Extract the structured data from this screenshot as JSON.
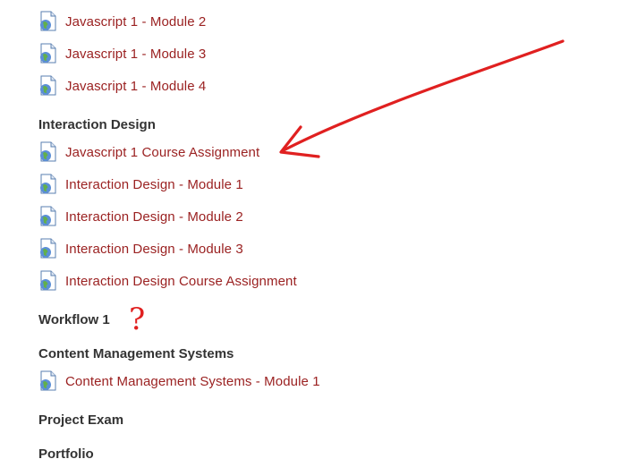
{
  "links_top": [
    {
      "label": "Javascript 1 - Module 2"
    },
    {
      "label": "Javascript 1 - Module 3"
    },
    {
      "label": "Javascript 1 - Module 4"
    }
  ],
  "section_interaction": {
    "title": "Interaction Design",
    "items": [
      {
        "label": "Javascript 1 Course Assignment"
      },
      {
        "label": "Interaction Design - Module 1"
      },
      {
        "label": "Interaction Design - Module 2"
      },
      {
        "label": "Interaction Design - Module 3"
      },
      {
        "label": "Interaction Design Course Assignment"
      }
    ]
  },
  "section_workflow": {
    "title": "Workflow 1"
  },
  "annotation_question": {
    "text": "?"
  },
  "section_cms": {
    "title": "Content Management Systems",
    "items": [
      {
        "label": "Content Management Systems - Module 1"
      }
    ]
  },
  "section_project": {
    "title": "Project Exam"
  },
  "section_portfolio": {
    "title": "Portfolio"
  },
  "colors": {
    "link": "#9b2222",
    "heading": "#333333",
    "annotation": "#e02020"
  },
  "icons": {
    "url_resource": "globe-document-icon",
    "annotation_arrow": "red-arrow"
  }
}
